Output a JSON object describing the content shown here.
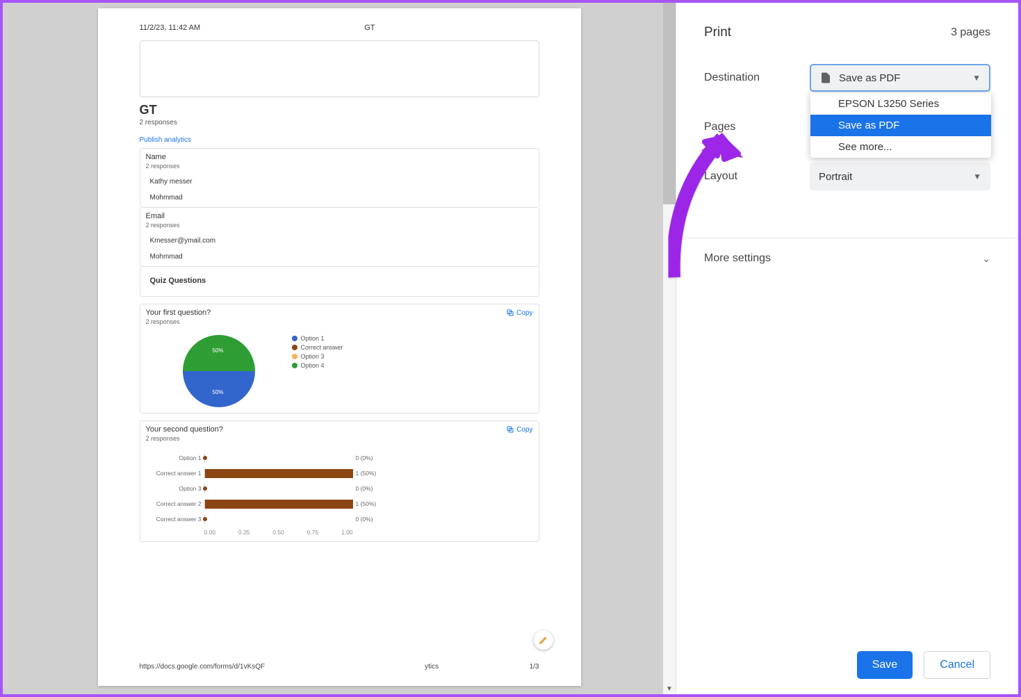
{
  "preview": {
    "timestamp": "11/2/23, 11:42 AM",
    "header_title": "GT",
    "doc_title": "GT",
    "responses": "2 responses",
    "publish": "Publish analytics",
    "name_section": {
      "label": "Name",
      "sub": "2 responses",
      "items": [
        "Kathy messer",
        "Mohmmad"
      ]
    },
    "email_section": {
      "label": "Email",
      "sub": "2 responses",
      "items": [
        "Kmesser@ymail.com",
        "Mohmmad"
      ]
    },
    "quiz_label": "Quiz Questions",
    "q1": {
      "title": "Your first question?",
      "sub": "2 responses",
      "copy": "Copy"
    },
    "q2": {
      "title": "Your second question?",
      "sub": "2 responses",
      "copy": "Copy"
    },
    "footer_url": "https://docs.google.com/forms/d/1vKsQF",
    "footer_suffix": "ytics",
    "footer_page": "1/3"
  },
  "chart_data": [
    {
      "type": "pie",
      "title": "Your first question?",
      "series": [
        {
          "name": "Option 1",
          "value": 50,
          "label": "50%",
          "color": "#3366cc"
        },
        {
          "name": "Correct answer",
          "value": 0,
          "color": "#8b4513"
        },
        {
          "name": "Option 3",
          "value": 0,
          "color": "#f4b266"
        },
        {
          "name": "Option 4",
          "value": 50,
          "label": "50%",
          "color": "#2e9e34"
        }
      ]
    },
    {
      "type": "bar",
      "title": "Your second question?",
      "xlim": [
        0,
        1
      ],
      "xticks": [
        "0.00",
        "0.25",
        "0.50",
        "0.75",
        "1.00"
      ],
      "categories": [
        "Option 1",
        "Correct answer 1",
        "Option 3",
        "Correct answer 2",
        "Correct answer 3"
      ],
      "values": [
        0,
        1,
        0,
        1,
        0
      ],
      "value_labels": [
        "0 (0%)",
        "1 (50%)",
        "0 (0%)",
        "1 (50%)",
        "0 (0%)"
      ]
    }
  ],
  "print": {
    "title": "Print",
    "page_count": "3 pages",
    "destination_label": "Destination",
    "destination_value": "Save as PDF",
    "destination_options": [
      "EPSON L3250 Series",
      "Save as PDF",
      "See more..."
    ],
    "pages_label": "Pages",
    "layout_label": "Layout",
    "layout_value": "Portrait",
    "more_settings": "More settings",
    "save": "Save",
    "cancel": "Cancel"
  }
}
